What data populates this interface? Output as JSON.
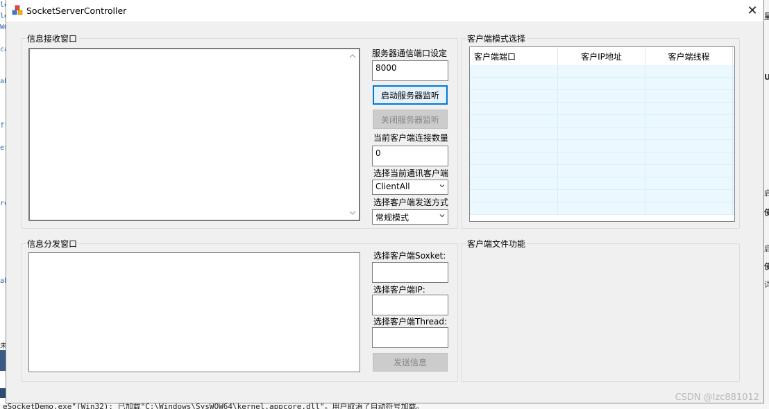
{
  "window": {
    "title": "SocketServerController",
    "close_glyph": "✕"
  },
  "receive_group": {
    "title": "信息接收窗口"
  },
  "server": {
    "port_label": "服务器通信端口设定",
    "port_value": "8000",
    "start_label": "启动服务器监听",
    "stop_label": "关闭服务器监听",
    "count_label": "当前客户端连接数量",
    "count_value": "0",
    "select_client_label": "选择当前通讯客户端",
    "select_client_value": "ClientAll",
    "send_mode_label": "选择客户端发送方式",
    "send_mode_value": "常规模式"
  },
  "mode_group": {
    "title": "客户端模式选择",
    "columns": [
      "客户端端口",
      "客户IP地址",
      "客户端线程"
    ]
  },
  "send_group": {
    "title": "信息分发窗口",
    "socket_label": "选择客户端Soxket:",
    "ip_label": "选择客户端IP:",
    "thread_label": "选择客户端Thread:",
    "send_label": "发送信息"
  },
  "file_group": {
    "title": "客户端文件功能"
  },
  "background": {
    "left_fragments": [
      "le",
      "le",
      "WO",
      "ca",
      "ab",
      "ff",
      "er",
      "ro",
      "ab",
      "未"
    ],
    "right_fragments": [
      "呈",
      "U",
      "启",
      "使",
      "启",
      "使",
      "词"
    ],
    "bottom_text": "eSocketDemo.exe\"(Win32): 已加载\"C:\\Windows\\SysWOW64\\kernel.appcore.dll\"。用户取消了自动符号加载。",
    "watermark": "CSDN @lzc881012"
  },
  "icons": {
    "app": "app-cubes-icon",
    "close": "close-icon",
    "dropdown": "chevron-down-icon",
    "scroll_up": "scroll-up-icon",
    "scroll_down": "scroll-down-icon"
  },
  "colors": {
    "accent": "#0078d7",
    "table_row": "#ebf9ff",
    "window_bg": "#f0f0f0"
  }
}
